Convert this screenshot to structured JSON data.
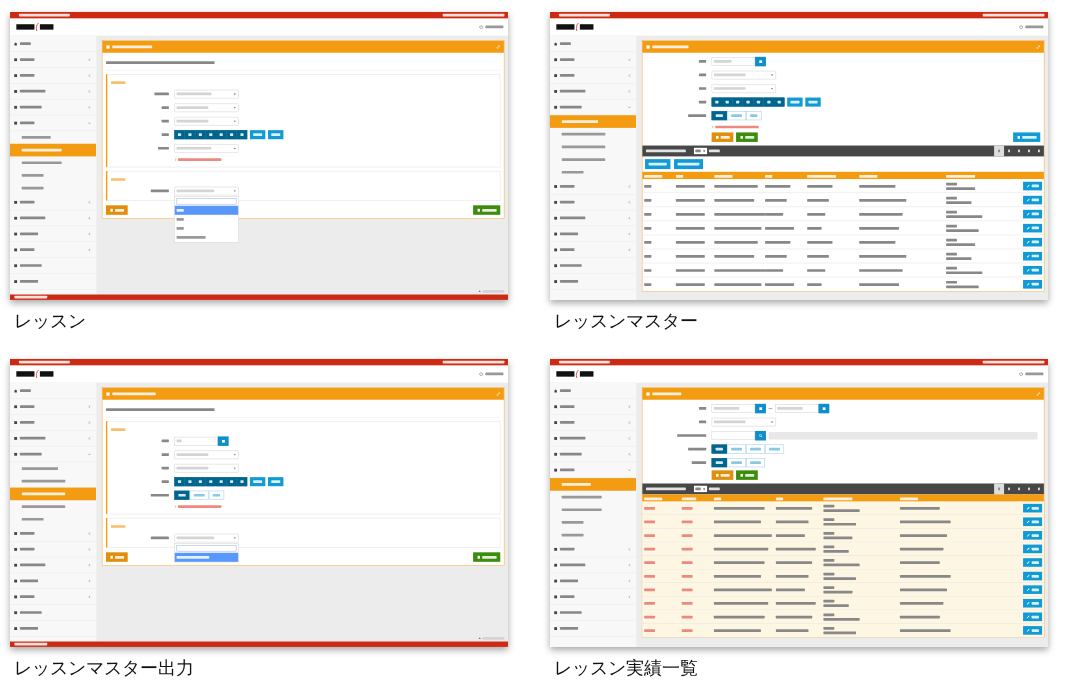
{
  "screens": [
    {
      "caption": "レッスン"
    },
    {
      "caption": "レッスンマスター"
    },
    {
      "caption": "レッスンマスター出力"
    },
    {
      "caption": "レッスン実績一覧"
    }
  ]
}
